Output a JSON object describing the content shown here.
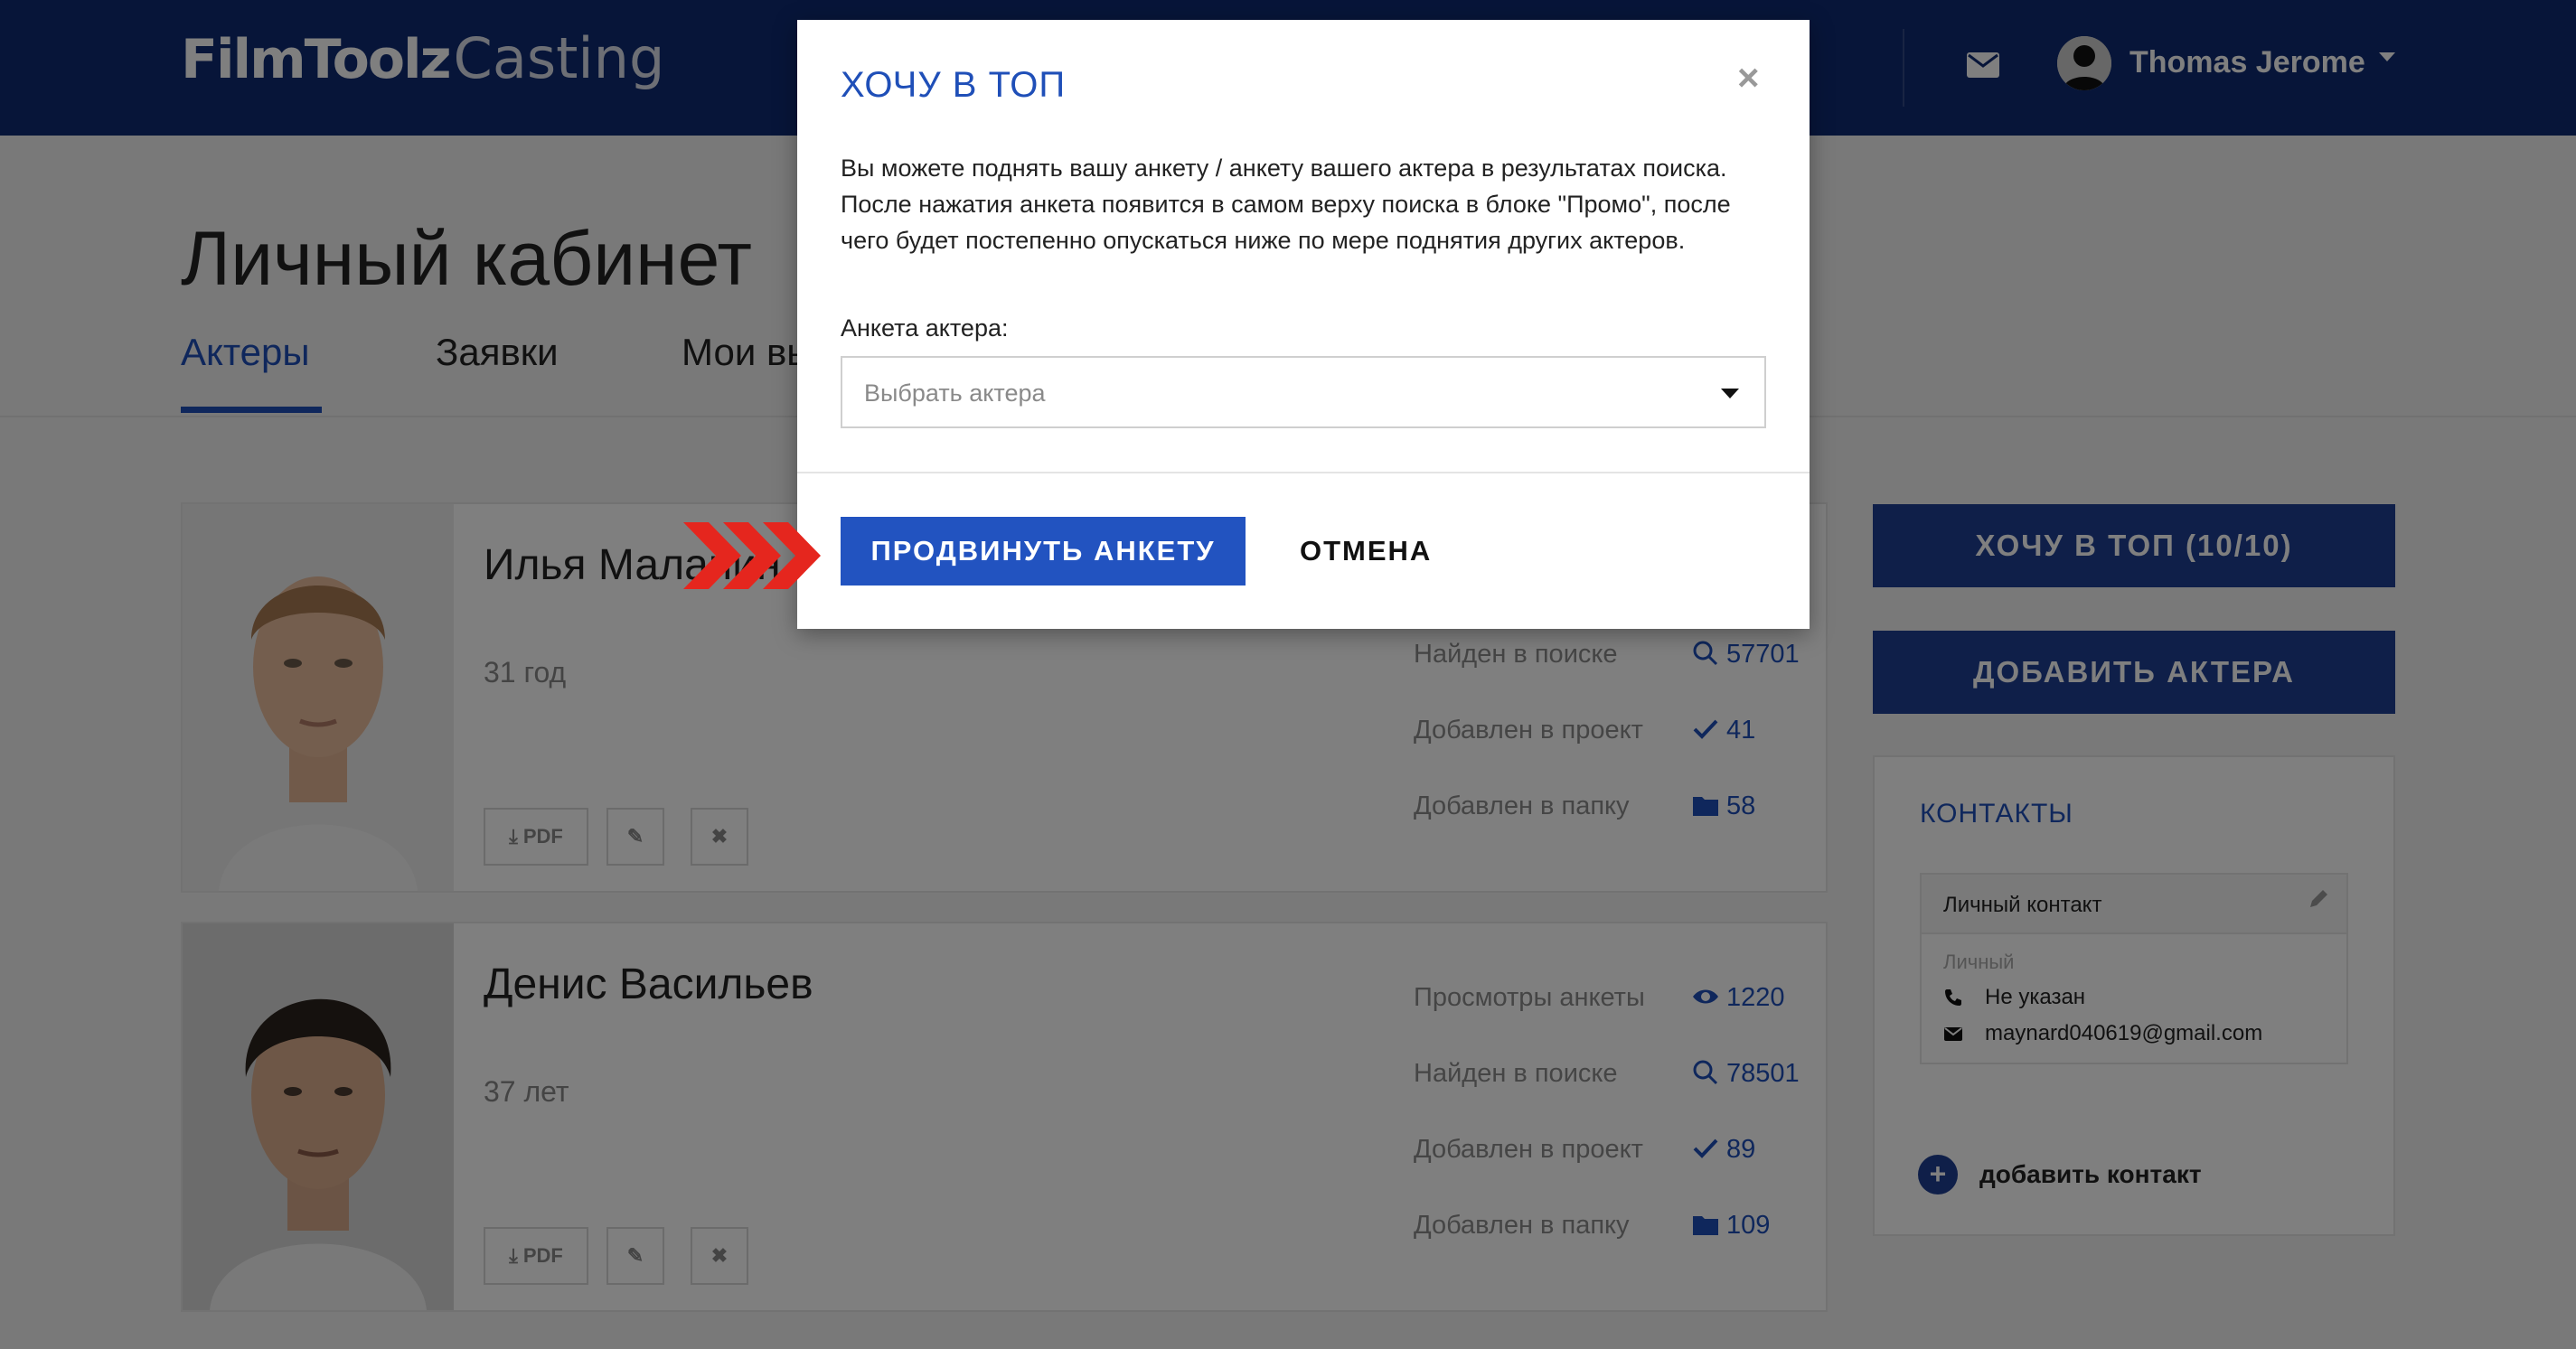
{
  "header": {
    "logo_bold": "FilmToolz",
    "logo_light": "Casting",
    "user_name": "Thomas Jerome",
    "icons": {
      "mail": "mail-icon",
      "avatar": "avatar",
      "caret": "caret-down-icon"
    }
  },
  "page": {
    "title": "Личный кабинет",
    "tabs": [
      {
        "label": "Актеры",
        "active": true
      },
      {
        "label": "Заявки",
        "active": false
      },
      {
        "label": "Мои вы",
        "active": false
      }
    ]
  },
  "actors": [
    {
      "name": "Илья Маланин",
      "age": "31 год",
      "pdf_label": "PDF",
      "stats": [
        {
          "label": "",
          "icon": "eye-icon",
          "value": ""
        },
        {
          "label": "Найден в поиске",
          "icon": "search-icon",
          "value": "57701"
        },
        {
          "label": "Добавлен в проект",
          "icon": "check-icon",
          "value": "41"
        },
        {
          "label": "Добавлен в папку",
          "icon": "folder-icon",
          "value": "58"
        }
      ]
    },
    {
      "name": "Денис Васильев",
      "age": "37 лет",
      "pdf_label": "PDF",
      "stats": [
        {
          "label": "Просмотры анкеты",
          "icon": "eye-icon",
          "value": "1220"
        },
        {
          "label": "Найден в поиске",
          "icon": "search-icon",
          "value": "78501"
        },
        {
          "label": "Добавлен в проект",
          "icon": "check-icon",
          "value": "89"
        },
        {
          "label": "Добавлен в папку",
          "icon": "folder-icon",
          "value": "109"
        }
      ]
    }
  ],
  "sidebar": {
    "top_button": "ХОЧУ В ТОП (10/10)",
    "add_actor_button": "ДОБАВИТЬ АКТЕРА",
    "contacts": {
      "title": "КОНТАКТЫ",
      "card_title": "Личный контакт",
      "type": "Личный",
      "phone": "Не указан",
      "email": "maynard040619@gmail.com",
      "add_label": "добавить контакт",
      "add_symbol": "+"
    }
  },
  "modal": {
    "title": "ХОЧУ В ТОП",
    "close_symbol": "×",
    "text": "Вы можете поднять вашу анкету / анкету вашего актера в результатах поиска. После нажатия анкета появится в самом верху поиска в блоке \"Промо\", после чего будет постепенно опускаться ниже по мере поднятия других актеров.",
    "field_label": "Анкета актера:",
    "select_placeholder": "Выбрать актера",
    "primary_button": "ПРОДВИНУТЬ АНКЕТУ",
    "cancel_button": "ОТМЕНА"
  },
  "colors": {
    "header_bg": "#0f2a73",
    "accent": "#1f4fb8",
    "primary_button": "#2253c0",
    "side_button": "#1f3e92",
    "arrow": "#e5261e"
  }
}
